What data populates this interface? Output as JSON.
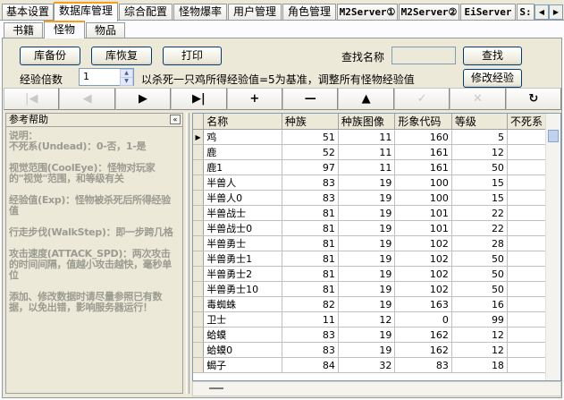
{
  "top_tabs": [
    {
      "label": "基本设置"
    },
    {
      "label": "数据库管理"
    },
    {
      "label": "综合配置"
    },
    {
      "label": "怪物爆率"
    },
    {
      "label": "用户管理"
    },
    {
      "label": "角色管理"
    },
    {
      "label": "M2Server①"
    },
    {
      "label": "M2Server②"
    },
    {
      "label": "EiServer"
    },
    {
      "label": "S:"
    }
  ],
  "sub_tabs": [
    {
      "label": "书籍"
    },
    {
      "label": "怪物"
    },
    {
      "label": "物品"
    }
  ],
  "toolbar": {
    "backup_label": "库备份",
    "restore_label": "库恢复",
    "print_label": "打印",
    "search_label": "查找名称",
    "search_value": "",
    "search_button": "查找",
    "exp_label": "经验倍数",
    "exp_value": "1",
    "exp_note": "以杀死一只鸡所得经验值=5为基准，调整所有怪物经验值",
    "modify_exp_button": "修改经验"
  },
  "navigator": [
    {
      "icon": "first-record-icon",
      "glyph": "|◀",
      "enabled": false
    },
    {
      "icon": "prior-record-icon",
      "glyph": "◀",
      "enabled": false
    },
    {
      "icon": "next-record-icon",
      "glyph": "▶",
      "enabled": true
    },
    {
      "icon": "last-record-icon",
      "glyph": "▶|",
      "enabled": true
    },
    {
      "icon": "insert-record-icon",
      "glyph": "+",
      "enabled": true
    },
    {
      "icon": "delete-record-icon",
      "glyph": "—",
      "enabled": true
    },
    {
      "icon": "edit-record-icon",
      "glyph": "▲",
      "enabled": true
    },
    {
      "icon": "post-record-icon",
      "glyph": "✓",
      "enabled": false
    },
    {
      "icon": "cancel-record-icon",
      "glyph": "✕",
      "enabled": false
    },
    {
      "icon": "refresh-icon",
      "glyph": "↻",
      "enabled": true
    }
  ],
  "help": {
    "title": "参考帮助",
    "collapse": "«",
    "body": "说明：\n不死系(Undead)：0-否，1-是\n\n视觉范围(CoolEye)：怪物对玩家的\"视觉\"范围，和等级有关\n\n经验值(Exp)：怪物被杀死后所得经验值\n\n行走步伐(WalkStep)：即一步跨几格\n\n攻击速度(ATTACK_SPD)：两次攻击的时间间隔，值越小攻击越快，毫秒单位\n\n添加、修改数据时请尽量参照已有数据，以免出错，影响服务器运行！"
  },
  "grid": {
    "columns": [
      "名称",
      "种族",
      "种族图像",
      "形象代码",
      "等级",
      "不死系"
    ],
    "current_row_marker": "▶",
    "rows": [
      [
        "鸡",
        "51",
        "11",
        "160",
        "5"
      ],
      [
        "鹿",
        "52",
        "11",
        "161",
        "12"
      ],
      [
        "鹿1",
        "97",
        "11",
        "161",
        "50"
      ],
      [
        "半兽人",
        "83",
        "19",
        "100",
        "15"
      ],
      [
        "半兽人0",
        "83",
        "19",
        "100",
        "15"
      ],
      [
        "半兽战士",
        "81",
        "19",
        "101",
        "22"
      ],
      [
        "半兽战士0",
        "81",
        "19",
        "101",
        "22"
      ],
      [
        "半兽勇士",
        "81",
        "19",
        "102",
        "28"
      ],
      [
        "半兽勇士1",
        "81",
        "19",
        "102",
        "50"
      ],
      [
        "半兽勇士2",
        "81",
        "19",
        "102",
        "50"
      ],
      [
        "半兽勇士10",
        "81",
        "19",
        "102",
        "50"
      ],
      [
        "毒蜘蛛",
        "82",
        "19",
        "163",
        "16"
      ],
      [
        "卫士",
        "11",
        "12",
        "0",
        "99"
      ],
      [
        "蛤蟆",
        "83",
        "19",
        "162",
        "12"
      ],
      [
        "蛤蟆0",
        "83",
        "19",
        "162",
        "12"
      ],
      [
        "蝎子",
        "84",
        "32",
        "83",
        "18"
      ]
    ]
  }
}
